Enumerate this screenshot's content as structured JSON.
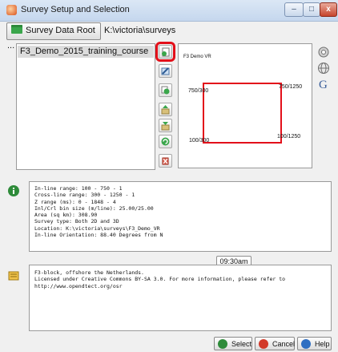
{
  "window": {
    "title": "Survey Setup and Selection",
    "minimize_label": "–",
    "maximize_label": "□",
    "close_label": "x"
  },
  "data_root": {
    "button_label": "Survey Data Root ...",
    "path": "K:\\victoria\\surveys"
  },
  "surveys": {
    "items": [
      "F3_Demo_2015_training_course"
    ]
  },
  "map": {
    "survey_name": "F3 Demo VR",
    "corners": {
      "top_left": "750/300",
      "top_right": "750/1250",
      "bottom_left": "100/300",
      "bottom_right": "100/1250"
    },
    "outline_color": "#e3101a"
  },
  "survey_info": {
    "lines": [
      "In-line range: 100 - 750 - 1",
      "Cross-line range: 300 - 1250 - 1",
      "Z range (ms): 0 - 1848 - 4",
      "Inl/Crl bin size (m/line): 25.00/25.00",
      "Area (sq km): 308.90",
      "Survey type: Both 2D and 3D",
      "Location: K:\\victoria\\surveys\\F3_Demo_VR",
      "In-line Orientation: 88.40 Degrees from N"
    ]
  },
  "notes": {
    "lines": [
      "F3-block, offshore the Netherlands.",
      "Licensed under Creative Commons BY-SA 3.0. For more information, please refer to",
      "http://www.opendtect.org/osr"
    ]
  },
  "tooltip": {
    "time": "09:30am"
  },
  "buttons": {
    "select": "Select",
    "cancel": "Cancel",
    "help": "Help"
  },
  "icons": {
    "title": "app-icon",
    "tools": [
      "new-survey-icon",
      "edit-survey-icon",
      "copy-survey-icon",
      "import-survey-icon",
      "export-survey-icon",
      "refresh-icon",
      "remove-survey-icon"
    ],
    "side": [
      "settings-icon",
      "globe-icon",
      "google-icon"
    ],
    "info": "info-icon",
    "notes": "notes-icon"
  }
}
